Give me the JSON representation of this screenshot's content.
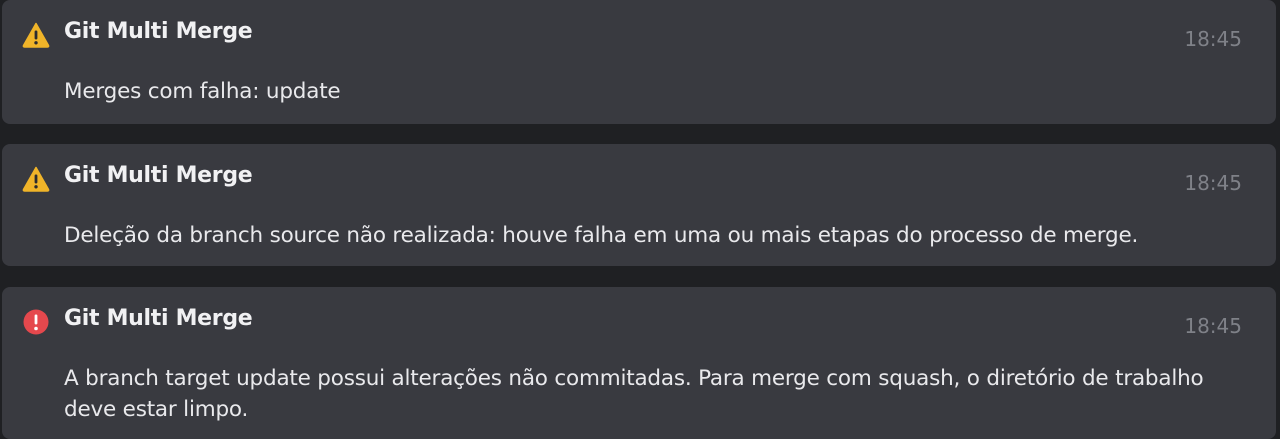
{
  "notifications": [
    {
      "severity": "warning",
      "icon": "warning-icon",
      "title": "Git Multi Merge",
      "time": "18:45",
      "message": "Merges com falha: update"
    },
    {
      "severity": "warning",
      "icon": "warning-icon",
      "title": "Git Multi Merge",
      "time": "18:45",
      "message": "Deleção da branch source não realizada: houve falha em uma ou mais etapas do processo de merge."
    },
    {
      "severity": "error",
      "icon": "error-icon",
      "title": "Git Multi Merge",
      "time": "18:45",
      "message": "A branch target update possui alterações não commitadas. Para merge com squash, o diretório de trabalho deve estar limpo."
    }
  ],
  "colors": {
    "warning": "#f0b429",
    "error": "#e5484d",
    "card_background": "#393a40",
    "timestamp": "#7f8188"
  }
}
